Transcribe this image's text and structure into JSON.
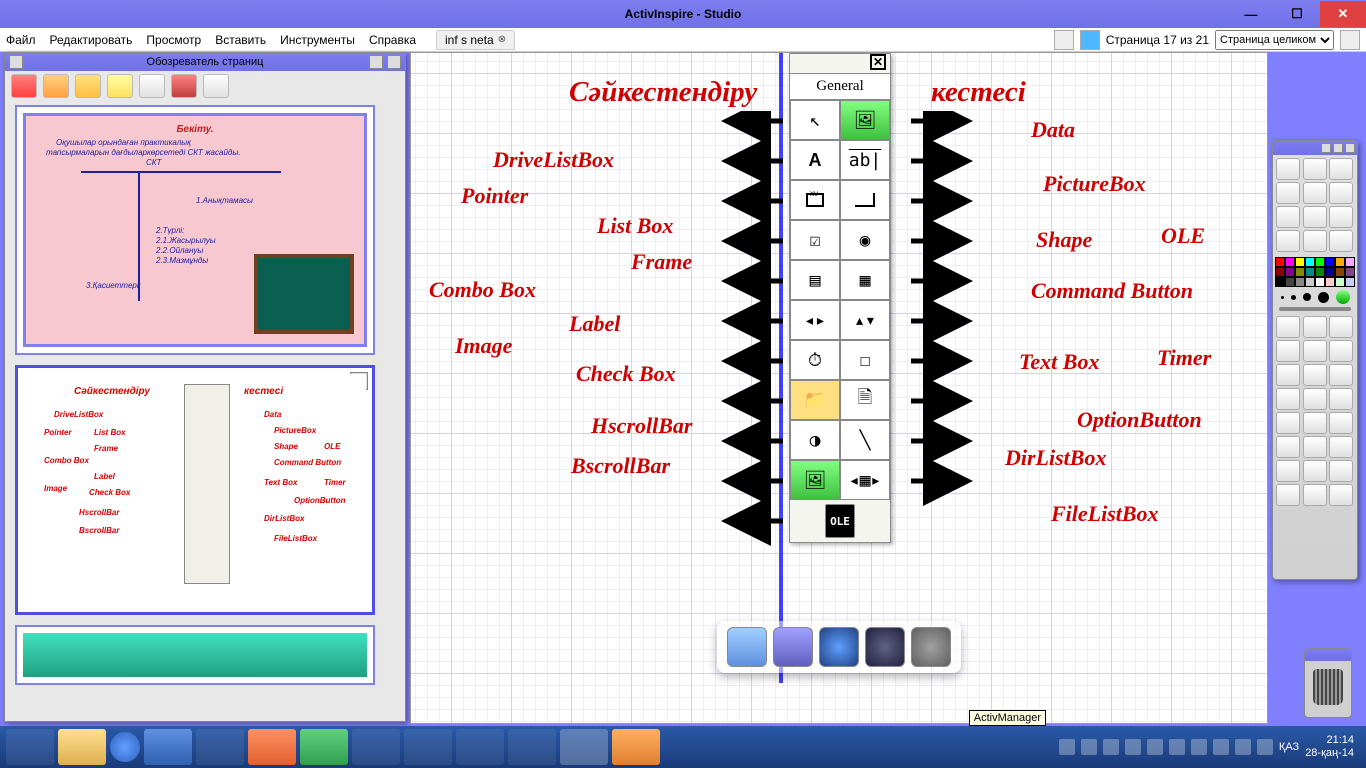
{
  "app": {
    "title": "ActivInspire - Studio"
  },
  "menu": {
    "file": "Файл",
    "edit": "Редактировать",
    "view": "Просмотр",
    "insert": "Вставить",
    "tools": "Инструменты",
    "help": "Справка"
  },
  "tab": {
    "label": "inf s neta"
  },
  "pageinfo": {
    "text": "Страница 17 из 21",
    "zoom": "Страница целиком"
  },
  "browser": {
    "title": "Обозреватель страниц"
  },
  "thumb1": {
    "title": "Бекіту.",
    "line1": "Оқушылар орындаған практикалық",
    "line2": "тапсырмаларын дағдыларкөрсетеді СКТ жасайды.",
    "line3": "СКТ",
    "i1": "1.Анықтамасы",
    "i2": "2.Түрлі:",
    "i2a": "2.1.Жасырылуы",
    "i2b": "2.2.Ойлануы",
    "i2c": "2.3.Мазмұнды",
    "i3": "3.Қасиеттері:"
  },
  "canvas": {
    "title_left": "Сәйкестендіру",
    "title_right": "кестесі",
    "left": {
      "drivelistbox": "DriveListBox",
      "pointer": "Pointer",
      "listbox": "List Box",
      "frame": "Frame",
      "combobox": "Combo Box",
      "label": "Label",
      "image": "Image",
      "checkbox": "Check Box",
      "hscrollbar": "HscrollBar",
      "bscrollbar": "BscrollBar"
    },
    "right": {
      "data": "Data",
      "picturebox": "PictureBox",
      "shape": "Shape",
      "ole": "OLE",
      "commandbutton": "Command Button",
      "textbox": "Text Box",
      "timer": "Timer",
      "optionbutton": "OptionButton",
      "dirlistbox": "DirListBox",
      "filelistbox": "FileListBox"
    }
  },
  "palette": {
    "title": "General",
    "ole": "OLE"
  },
  "systray": {
    "tooltip": "ActivManager",
    "lang": "ҚАЗ",
    "time": "21:14",
    "date": "28-қаң-14"
  }
}
